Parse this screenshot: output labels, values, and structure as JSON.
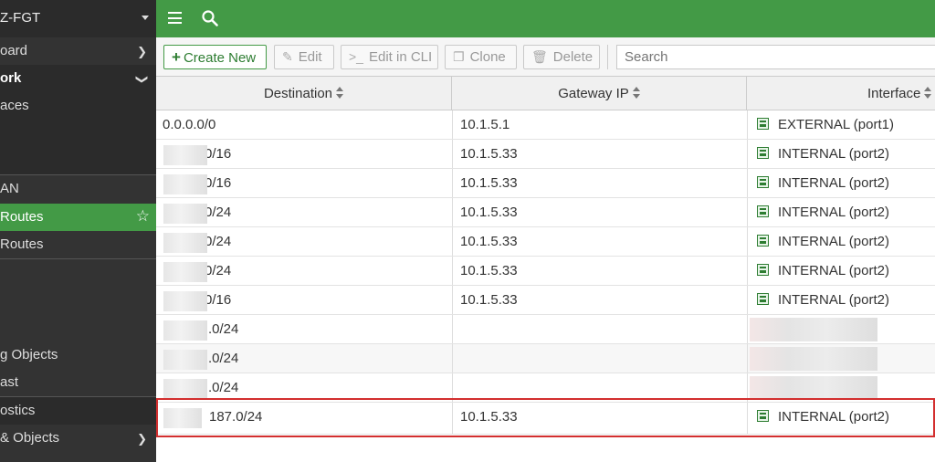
{
  "sidebar": {
    "device_name": "Z-FGT",
    "items": [
      {
        "label": "oard"
      },
      {
        "label": "ork"
      },
      {
        "label": "aces"
      },
      {
        "label": "AN"
      },
      {
        "label": "Routes"
      },
      {
        "label": "Routes"
      },
      {
        "label": "g Objects"
      },
      {
        "label": "ast"
      },
      {
        "label": "ostics"
      },
      {
        "label": "& Objects"
      }
    ]
  },
  "toolbar": {
    "create_new": "Create New",
    "edit": "Edit",
    "edit_in_cli": "Edit in CLI",
    "clone": "Clone",
    "delete": "Delete",
    "search_placeholder": "Search"
  },
  "table": {
    "columns": [
      "Destination",
      "Gateway IP",
      "Interface"
    ],
    "rows": [
      {
        "destination": "0.0.0.0/0",
        "gateway": "10.1.5.1",
        "interface": "EXTERNAL (port1)"
      },
      {
        "destination": "0/16",
        "gateway": "10.1.5.33",
        "interface": "INTERNAL (port2)"
      },
      {
        "destination": "0/16",
        "gateway": "10.1.5.33",
        "interface": "INTERNAL (port2)"
      },
      {
        "destination": "0/24",
        "gateway": "10.1.5.33",
        "interface": "INTERNAL (port2)"
      },
      {
        "destination": "0/24",
        "gateway": "10.1.5.33",
        "interface": "INTERNAL (port2)"
      },
      {
        "destination": "0/24",
        "gateway": "10.1.5.33",
        "interface": "INTERNAL (port2)"
      },
      {
        "destination": "0/16",
        "gateway": "10.1.5.33",
        "interface": "INTERNAL (port2)"
      },
      {
        "destination": ".0/24",
        "gateway": "",
        "interface": ""
      },
      {
        "destination": ".0/24",
        "gateway": "",
        "interface": ""
      },
      {
        "destination": ".0/24",
        "gateway": "",
        "interface": ""
      },
      {
        "destination": "187.0/24",
        "gateway": "10.1.5.33",
        "interface": "INTERNAL (port2)"
      }
    ]
  },
  "colors": {
    "brand_green": "#439a46",
    "sidebar_bg": "#333333",
    "highlight_red": "#d32f2f"
  },
  "icons": {
    "menu": "hamburger-icon",
    "search": "search-icon",
    "port": "network-port-icon"
  }
}
